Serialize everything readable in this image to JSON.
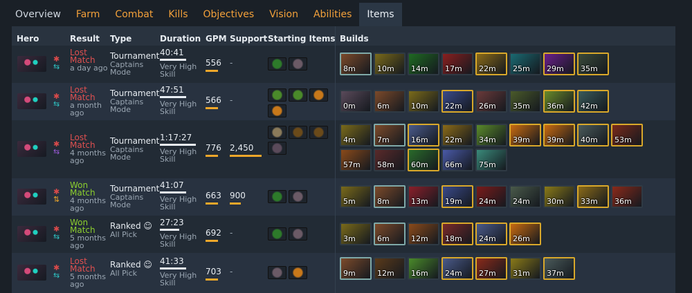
{
  "tabs": [
    "Overview",
    "Farm",
    "Combat",
    "Kills",
    "Objectives",
    "Vision",
    "Abilities",
    "Items"
  ],
  "active_tab": "Items",
  "columns": [
    "Hero",
    "Result",
    "Type",
    "Duration",
    "GPM",
    "Support",
    "Starting Items",
    "Builds"
  ],
  "colors": {
    "win": "#8ccf2e",
    "loss": "#e05050",
    "accent": "#f0a72a"
  },
  "rows": [
    {
      "result": "Lost Match",
      "ago": "a day ago",
      "type": "Tournament",
      "mode": "Captains Mode",
      "duration": "40:41",
      "skill": "Very High Skill",
      "gpm": "556",
      "support": "-",
      "start": [
        "#2d7a2a",
        "#6b5a66"
      ],
      "builds": [
        [
          "8m",
          "#7c4a2a",
          2
        ],
        [
          "10m",
          "#7a6a1a",
          3
        ],
        [
          "14m",
          "#1f6a22",
          3
        ],
        [
          "17m",
          "#8a1f1f",
          3
        ],
        [
          "22m",
          "#8a6a18",
          1
        ],
        [
          "25m",
          "#1a6a72",
          3
        ],
        [
          "29m",
          "#6a1f8a",
          1
        ],
        [
          "35m",
          "#3a4a3a",
          1
        ]
      ]
    },
    {
      "result": "Lost Match",
      "ago": "a month ago",
      "type": "Tournament",
      "mode": "Captains Mode",
      "duration": "47:51",
      "skill": "Very High Skill",
      "gpm": "566",
      "support": "-",
      "start": [
        "#4a8a2a",
        "#4a8a2a",
        "#c8781a",
        "#c8781a"
      ],
      "builds": [
        [
          "0m",
          "#5a4a5a",
          3
        ],
        [
          "6m",
          "#7c4a2a",
          3
        ],
        [
          "10m",
          "#7a6a1a",
          3
        ],
        [
          "22m",
          "#3a4a8a",
          1
        ],
        [
          "26m",
          "#6a3a3a",
          3
        ],
        [
          "35m",
          "#4a5a2a",
          3
        ],
        [
          "36m",
          "#6a8a2a",
          1
        ],
        [
          "42m",
          "#3a5a5a",
          1
        ]
      ]
    },
    {
      "result": "Lost Match",
      "ago": "4 months ago",
      "type": "Tournament",
      "mode": "Captains Mode",
      "duration": "1:17:27",
      "skill": "Very High Skill",
      "gpm": "776",
      "support": "2,450",
      "start": [
        "#8a7a5a",
        "#6a4a1a",
        "#6a4a1a",
        "#5a4a5a"
      ],
      "builds": [
        [
          "4m",
          "#7a6a1a",
          3
        ],
        [
          "7m",
          "#7c4a2a",
          2
        ],
        [
          "16m",
          "#4a5a8a",
          1
        ],
        [
          "22m",
          "#8a6a18",
          3
        ],
        [
          "34m",
          "#5a8a2a",
          3
        ],
        [
          "39m",
          "#c86a10",
          1
        ],
        [
          "39m",
          "#c86a10",
          1
        ],
        [
          "40m",
          "#4a5a5a",
          1
        ],
        [
          "53m",
          "#7a2a1a",
          1
        ],
        [
          "57m",
          "#8a4a1a",
          3
        ],
        [
          "58m",
          "#5a2a2a",
          3
        ],
        [
          "60m",
          "#2a6a2a",
          1
        ],
        [
          "66m",
          "#4a5aa8",
          3
        ],
        [
          "75m",
          "#3a8a7a",
          3
        ]
      ]
    },
    {
      "result": "Won Match",
      "ago": "4 months ago",
      "type": "Tournament",
      "mode": "Captains Mode",
      "duration": "41:07",
      "skill": "Very High Skill",
      "gpm": "663",
      "support": "900",
      "start": [
        "#2d7a2a",
        "#6b5a66"
      ],
      "builds": [
        [
          "5m",
          "#7a6a1a",
          3
        ],
        [
          "8m",
          "#7c4a2a",
          2
        ],
        [
          "13m",
          "#8a1f2a",
          3
        ],
        [
          "19m",
          "#3a4a8a",
          1
        ],
        [
          "24m",
          "#7a1a1a",
          3
        ],
        [
          "24m",
          "#4a5a4a",
          3
        ],
        [
          "30m",
          "#8a7a18",
          3
        ],
        [
          "33m",
          "#8a6a18",
          1
        ],
        [
          "36m",
          "#8a2a1a",
          3
        ]
      ]
    },
    {
      "result": "Won Match",
      "ago": "5 months ago",
      "type": "Ranked",
      "mode": "All Pick",
      "duration": "27:23",
      "skill": "Very High Skill",
      "gpm": "692",
      "support": "-",
      "start": [
        "#2d7a2a",
        "#6b5a66"
      ],
      "builds": [
        [
          "3m",
          "#7a6a1a",
          3
        ],
        [
          "6m",
          "#7c4a2a",
          2
        ],
        [
          "12m",
          "#8a4a1a",
          3
        ],
        [
          "18m",
          "#7a2a2a",
          1
        ],
        [
          "24m",
          "#4a5a8a",
          1
        ],
        [
          "26m",
          "#c86a10",
          1
        ]
      ]
    },
    {
      "result": "Lost Match",
      "ago": "5 months ago",
      "type": "Ranked",
      "mode": "All Pick",
      "duration": "41:33",
      "skill": "Very High Skill",
      "gpm": "703",
      "support": "-",
      "start": [
        "#6b5a66",
        "#c8781a"
      ],
      "builds": [
        [
          "9m",
          "#7c4a2a",
          2
        ],
        [
          "12m",
          "#5a3a1a",
          3
        ],
        [
          "16m",
          "#4a8a2a",
          3
        ],
        [
          "24m",
          "#4a5a8a",
          1
        ],
        [
          "27m",
          "#8a2a1a",
          1
        ],
        [
          "31m",
          "#8a7a18",
          3
        ],
        [
          "37m",
          "#4a5a5a",
          1
        ]
      ]
    }
  ]
}
